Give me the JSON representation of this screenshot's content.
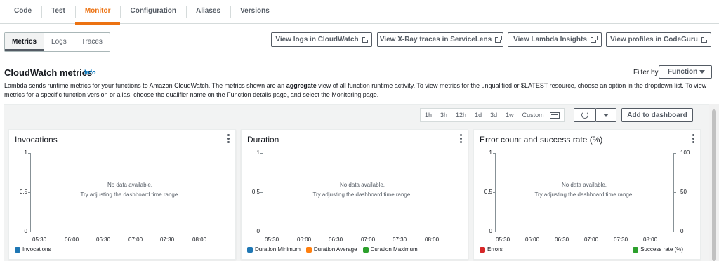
{
  "tabs": [
    {
      "label": "Code"
    },
    {
      "label": "Test"
    },
    {
      "label": "Monitor",
      "active": true
    },
    {
      "label": "Configuration"
    },
    {
      "label": "Aliases"
    },
    {
      "label": "Versions"
    }
  ],
  "subtabs": [
    {
      "label": "Metrics",
      "active": true
    },
    {
      "label": "Logs"
    },
    {
      "label": "Traces"
    }
  ],
  "actions": {
    "view_logs": "View logs in CloudWatch",
    "view_xray": "View X-Ray traces in ServiceLens",
    "view_insights": "View Lambda Insights",
    "view_profiles": "View profiles in CodeGuru"
  },
  "section": {
    "title": "CloudWatch metrics",
    "info": "Info",
    "filter_label": "Filter by",
    "filter_value": "Function",
    "desc_before": "Lambda sends runtime metrics for your functions to Amazon CloudWatch. The metrics shown are an ",
    "desc_bold": "aggregate",
    "desc_after": " view of all function runtime activity. To view metrics for the unqualified or $LATEST resource, choose an option in the dropdown list. To view metrics for a specific function version or alias, choose the qualifier name on the Function details page, and select the Monitoring page."
  },
  "toolbar": {
    "ranges": [
      "1h",
      "3h",
      "12h",
      "1d",
      "3d",
      "1w",
      "Custom"
    ],
    "add_to_dashboard": "Add to dashboard"
  },
  "colors": {
    "accent": "#ec7211",
    "link": "#0073bb",
    "blue": "#1f77b4",
    "orange": "#ff7f0e",
    "green": "#2ca02c",
    "red": "#d62728"
  },
  "panels": [
    {
      "title": "Invocations",
      "no_data": "No data available.",
      "hint": "Try adjusting the dashboard time range.",
      "y_left": [
        "1",
        "0.5",
        "0"
      ],
      "y_right": [],
      "x_ticks": [
        "05:30",
        "06:00",
        "06:30",
        "07:00",
        "07:30",
        "08:00"
      ],
      "legend": [
        {
          "label": "Invocations",
          "color": "#1f77b4"
        }
      ]
    },
    {
      "title": "Duration",
      "no_data": "No data available.",
      "hint": "Try adjusting the dashboard time range.",
      "y_left": [
        "1",
        "0.5",
        "0"
      ],
      "y_right": [],
      "x_ticks": [
        "05:30",
        "06:00",
        "06:30",
        "07:00",
        "07:30",
        "08:00"
      ],
      "legend": [
        {
          "label": "Duration Minimum",
          "color": "#1f77b4"
        },
        {
          "label": "Duration Average",
          "color": "#ff7f0e"
        },
        {
          "label": "Duration Maximum",
          "color": "#2ca02c"
        }
      ]
    },
    {
      "title": "Error count and success rate (%)",
      "no_data": "No data available.",
      "hint": "Try adjusting the dashboard time range.",
      "y_left": [
        "1",
        "0.5",
        "0"
      ],
      "y_right": [
        "100",
        "50",
        "0"
      ],
      "x_ticks": [
        "05:30",
        "06:00",
        "06:30",
        "07:00",
        "07:30",
        "08:00"
      ],
      "legend": [
        {
          "label": "Errors",
          "color": "#d62728"
        },
        {
          "label": "Success rate (%)",
          "color": "#2ca02c"
        }
      ]
    }
  ]
}
